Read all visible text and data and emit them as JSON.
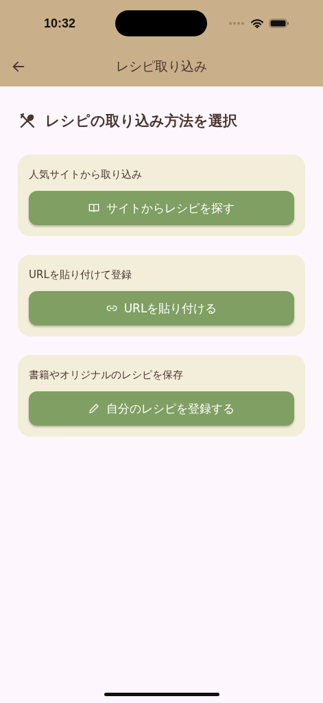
{
  "status_bar": {
    "time": "10:32"
  },
  "app_bar": {
    "title": "レシピ取り込み"
  },
  "heading": "レシピの取り込み方法を選択",
  "options": [
    {
      "kind": "book",
      "description": "人気サイトから取り込み",
      "button": "サイトからレシピを探す"
    },
    {
      "kind": "link",
      "description": "URLを貼り付けて登録",
      "button": "URLを貼り付ける"
    },
    {
      "kind": "pencil",
      "description": "書籍やオリジナルのレシピを保存",
      "button": "自分のレシピを登録する"
    }
  ]
}
